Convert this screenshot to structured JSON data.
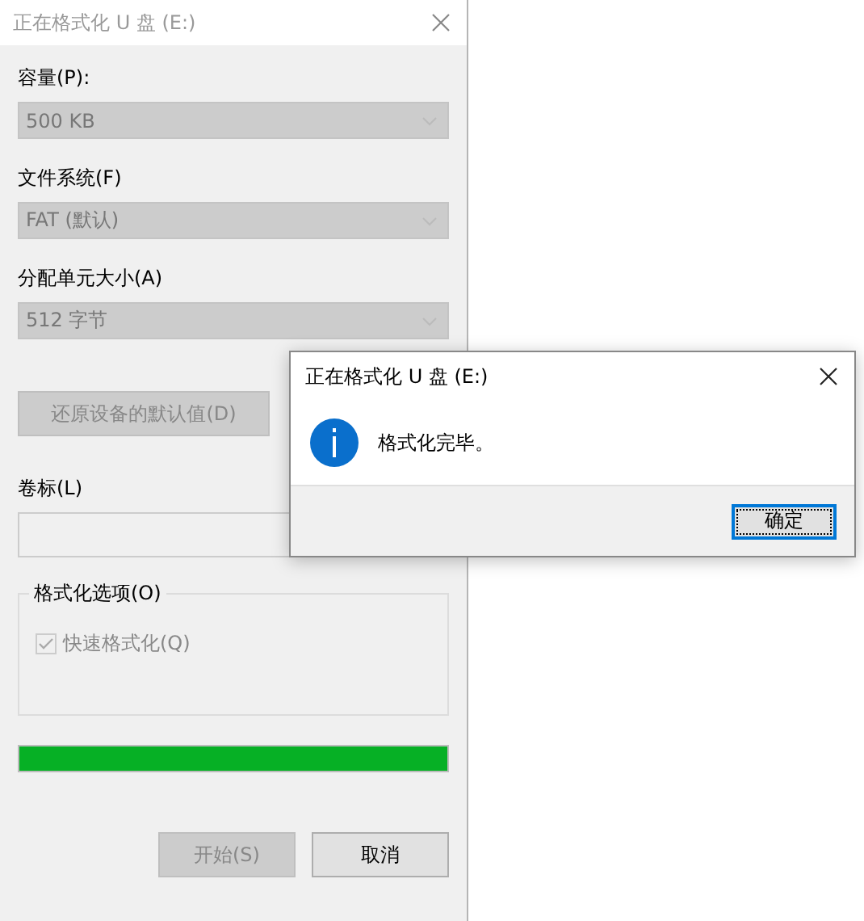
{
  "format_window": {
    "title": "正在格式化 U 盘 (E:)",
    "active": false,
    "fields": [
      {
        "kind": "dropdown",
        "label": "容量(P):",
        "value": "500 KB",
        "disabled": true
      },
      {
        "kind": "dropdown",
        "label": "文件系统(F)",
        "value": "FAT (默认)",
        "disabled": true
      },
      {
        "kind": "dropdown",
        "label": "分配单元大小(A)",
        "value": "512 字节",
        "disabled": true
      }
    ],
    "restore_button": {
      "label": "还原设备的默认值(D)",
      "disabled": true
    },
    "volume_label": {
      "label": "卷标(L)",
      "disabled": true
    },
    "options": {
      "legend": "格式化选项(O)",
      "checkboxes": [
        {
          "label": "快速格式化(Q)",
          "checked": true,
          "disabled": true
        }
      ]
    },
    "progress": {
      "level": 1
    },
    "buttons": [
      {
        "label": "开始(S)",
        "disabled": true
      },
      {
        "label": "取消",
        "disabled": false
      }
    ]
  },
  "message_box": {
    "title": "正在格式化 U 盘 (E:)",
    "active": true,
    "message": "格式化完毕。",
    "buttons": [
      {
        "label": "确定",
        "focused": true
      }
    ]
  }
}
